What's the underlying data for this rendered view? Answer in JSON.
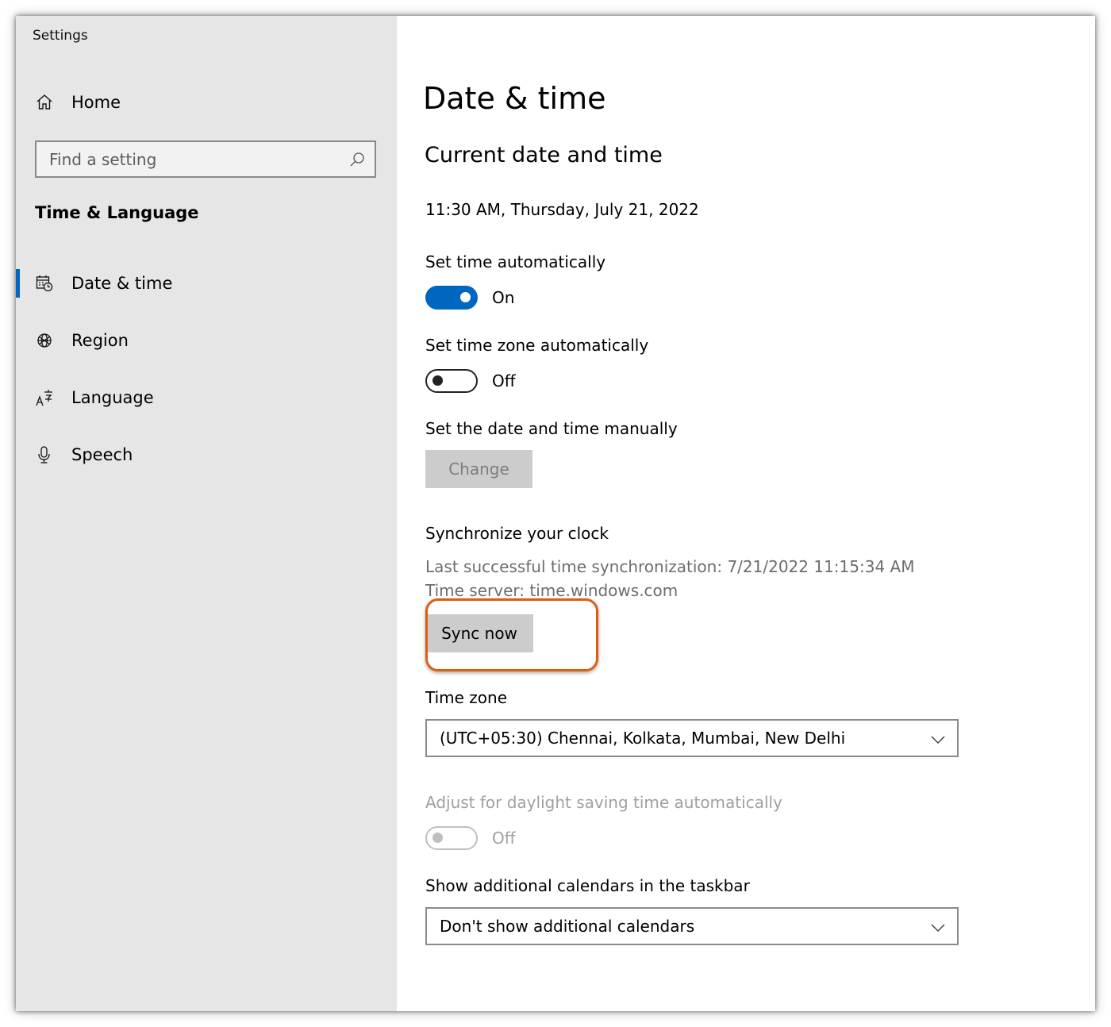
{
  "app": {
    "title": "Settings"
  },
  "sidebar": {
    "home": {
      "label": "Home",
      "icon": "home-icon"
    },
    "search": {
      "placeholder": "Find a setting",
      "icon": "search-icon"
    },
    "section_title": "Time & Language",
    "items": [
      {
        "label": "Date & time",
        "icon": "calendar-clock-icon",
        "active": true
      },
      {
        "label": "Region",
        "icon": "globe-icon",
        "active": false
      },
      {
        "label": "Language",
        "icon": "language-icon",
        "active": false
      },
      {
        "label": "Speech",
        "icon": "microphone-icon",
        "active": false
      }
    ],
    "accent": "#0067c0"
  },
  "main": {
    "title": "Date & time",
    "subtitle": "Current date and time",
    "current_datetime": "11:30 AM, Thursday, July 21, 2022",
    "set_time_auto": {
      "label": "Set time automatically",
      "state": "On",
      "on": true
    },
    "set_timezone_auto": {
      "label": "Set time zone automatically",
      "state": "Off",
      "on": false
    },
    "manual": {
      "label": "Set the date and time manually",
      "button": "Change",
      "enabled": false
    },
    "sync": {
      "label": "Synchronize your clock",
      "last_sync": "Last successful time synchronization: 7/21/2022 11:15:34 AM",
      "server": "Time server: time.windows.com",
      "button": "Sync now",
      "highlight_color": "#e05d0e"
    },
    "timezone": {
      "label": "Time zone",
      "value": "(UTC+05:30) Chennai, Kolkata, Mumbai, New Delhi"
    },
    "dst": {
      "label": "Adjust for daylight saving time automatically",
      "state": "Off",
      "on": false,
      "enabled": false
    },
    "calendars": {
      "label": "Show additional calendars in the taskbar",
      "value": "Don't show additional calendars"
    }
  }
}
